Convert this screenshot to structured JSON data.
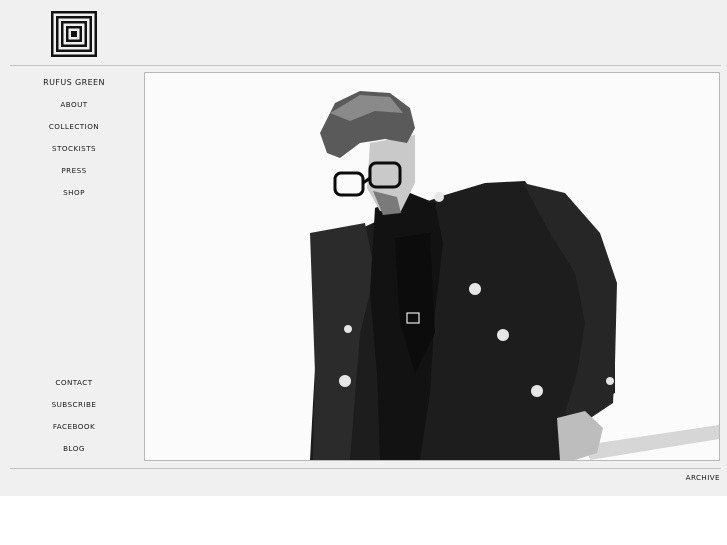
{
  "brand": {
    "name": "RUFUS GREEN"
  },
  "nav_main": [
    "ABOUT",
    "COLLECTION",
    "STOCKISTS",
    "PRESS",
    "SHOP"
  ],
  "nav_secondary": [
    "CONTACT",
    "SUBSCRIBE",
    "FACEBOOK",
    "BLOG"
  ],
  "footer": {
    "archive_label": "ARCHIVE"
  },
  "colors": {
    "background": "#f0f0f0",
    "text": "#1a1a1a",
    "rule": "#c4c4c4"
  },
  "icons": {
    "logo": "concentric-squares-logo"
  }
}
